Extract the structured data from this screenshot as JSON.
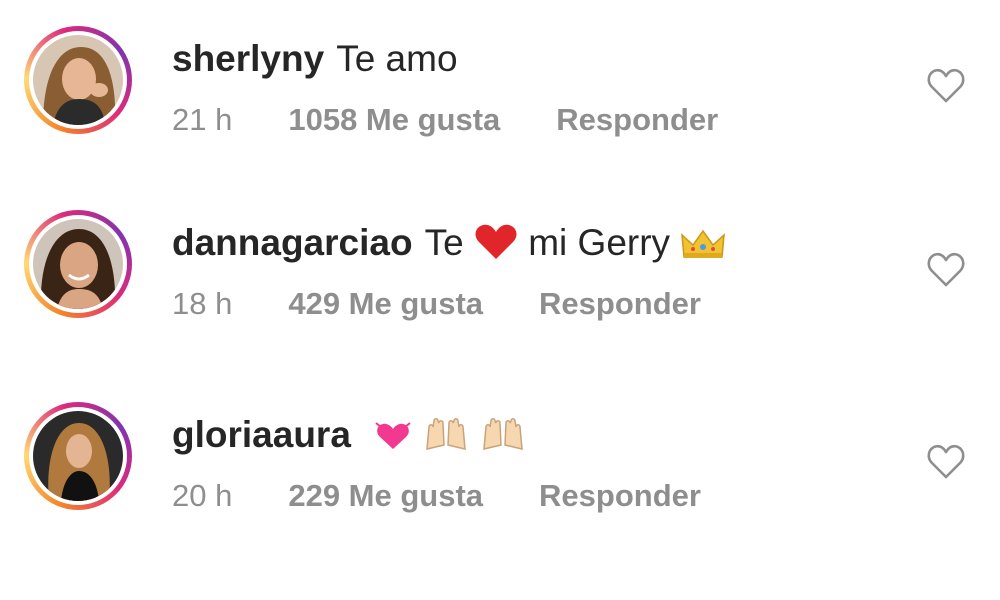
{
  "comments": [
    {
      "username": "sherlyny",
      "text": "Te amo",
      "time": "21 h",
      "likes": "1058 Me gusta",
      "reply": "Responder",
      "emojis": []
    },
    {
      "username": "dannagarciao",
      "text_before": "Te",
      "text_after": "mi Gerry",
      "emojis": [
        "red-heart",
        "crown"
      ],
      "time": "18 h",
      "likes": "429 Me gusta",
      "reply": "Responder"
    },
    {
      "username": "gloriaaura",
      "emojis": [
        "growing-heart",
        "raising-hands",
        "raising-hands"
      ],
      "time": "20 h",
      "likes": "229 Me gusta",
      "reply": "Responder"
    }
  ],
  "icons": {
    "like": "heart-outline-icon"
  },
  "colors": {
    "text_primary": "#262626",
    "text_secondary": "#8e8e8e",
    "ring_gradient": [
      "#f58529",
      "#feda77",
      "#dd2a7b",
      "#8134af"
    ]
  }
}
